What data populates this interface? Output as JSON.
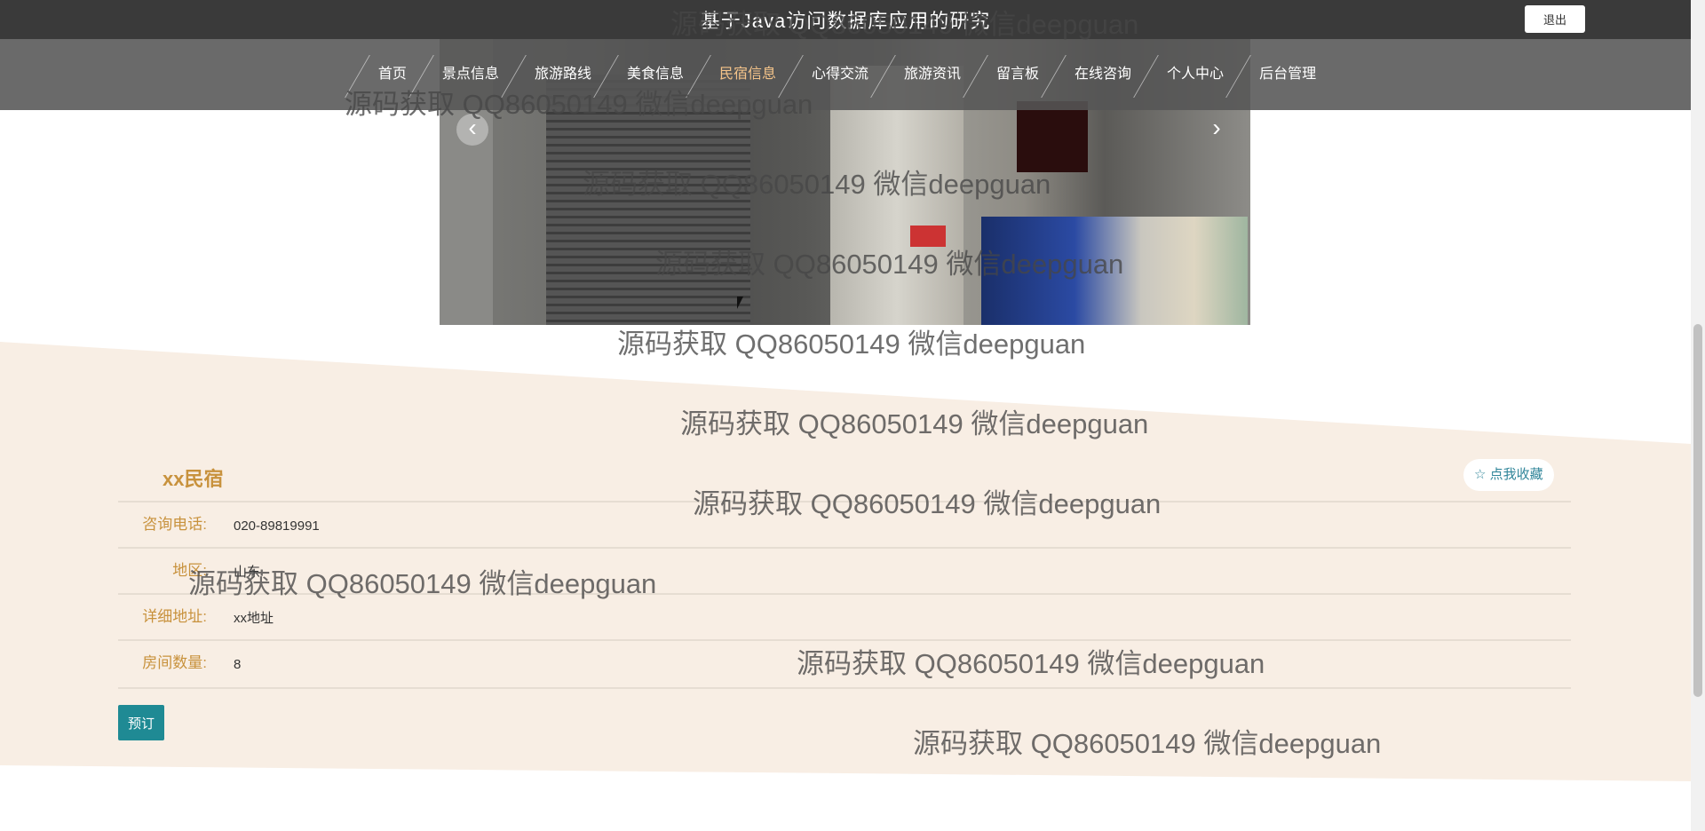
{
  "header": {
    "site_title": "基于Java访问数据库应用的研究",
    "logout_label": "退出"
  },
  "nav": {
    "items": [
      {
        "label": "首页"
      },
      {
        "label": "景点信息"
      },
      {
        "label": "旅游路线"
      },
      {
        "label": "美食信息"
      },
      {
        "label": "民宿信息",
        "active": true
      },
      {
        "label": "心得交流"
      },
      {
        "label": "旅游资讯"
      },
      {
        "label": "留言板"
      },
      {
        "label": "在线咨询"
      },
      {
        "label": "个人中心"
      },
      {
        "label": "后台管理"
      }
    ]
  },
  "banner": {
    "prev_icon": "‹",
    "next_icon": "›"
  },
  "detail": {
    "title": "xx民宿",
    "favorite_label": "☆ 点我收藏",
    "fields": [
      {
        "label": "咨询电话:",
        "value": "020-89819991"
      },
      {
        "label": "地区:",
        "value": "山东"
      },
      {
        "label": "详细地址:",
        "value": "xx地址"
      },
      {
        "label": "房间数量:",
        "value": "8"
      }
    ],
    "book_label": "预订"
  },
  "watermark": {
    "text": "源码获取 QQ86050149 微信deepguan"
  },
  "colors": {
    "accent_gold": "#c8923d",
    "teal_button": "#1f8a94",
    "band_beige": "#f8eee4",
    "nav_active": "#f5c48a"
  }
}
